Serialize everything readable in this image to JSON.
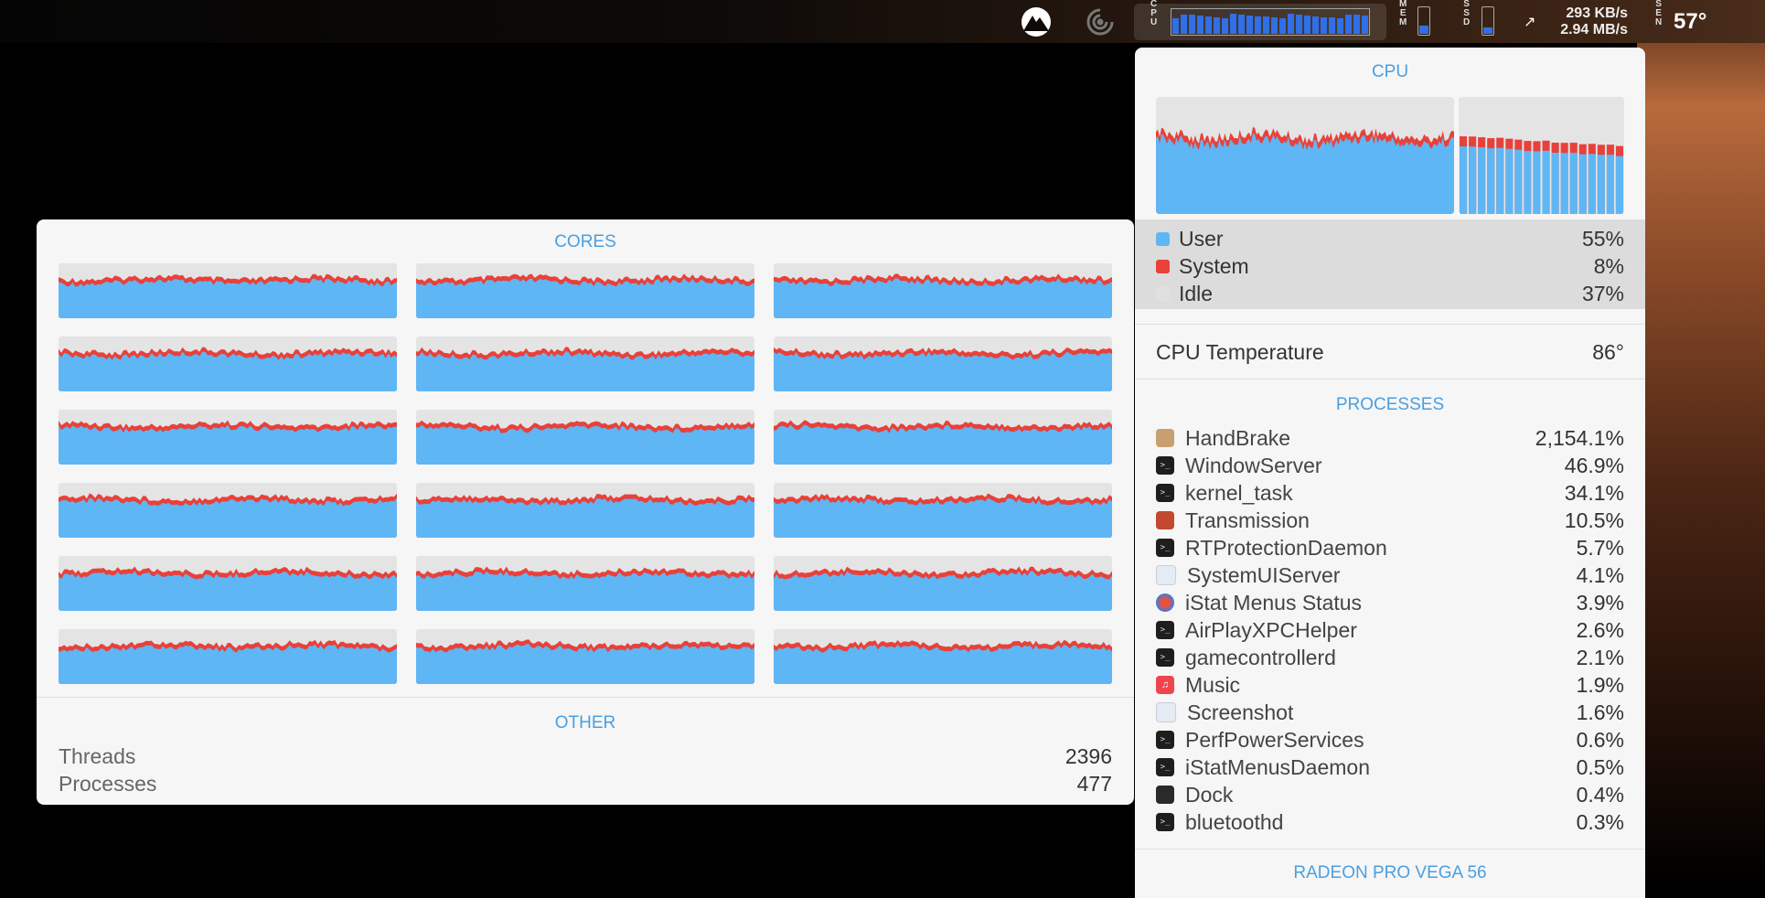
{
  "menubar": {
    "cpu_label": [
      "C",
      "P",
      "U"
    ],
    "mem_label": [
      "M",
      "E",
      "M"
    ],
    "ssd_label": [
      "S",
      "S",
      "D"
    ],
    "sen_label": [
      "S",
      "E",
      "N"
    ],
    "net_up": "293 KB/s",
    "net_down": "2.94 MB/s",
    "temperature": "57°",
    "mem_fill_percent": 30,
    "ssd_fill_percent": 25
  },
  "cores_panel": {
    "title": "CORES",
    "core_count": 18,
    "other_title": "OTHER",
    "stats": [
      {
        "label": "Threads",
        "value": "2396"
      },
      {
        "label": "Processes",
        "value": "477"
      }
    ]
  },
  "cpu_panel": {
    "title": "CPU",
    "legend": [
      {
        "label": "User",
        "value": "55%",
        "color": "#5fb6f5"
      },
      {
        "label": "System",
        "value": "8%",
        "color": "#e8413a"
      },
      {
        "label": "Idle",
        "value": "37%",
        "color": "#e0e0e0"
      }
    ],
    "temperature_label": "CPU Temperature",
    "temperature_value": "86°",
    "processes_title": "PROCESSES",
    "processes": [
      {
        "name": "HandBrake",
        "value": "2,154.1%",
        "icon": "handbrake-icon"
      },
      {
        "name": "WindowServer",
        "value": "46.9%",
        "icon": "terminal-icon"
      },
      {
        "name": "kernel_task",
        "value": "34.1%",
        "icon": "terminal-icon"
      },
      {
        "name": "Transmission",
        "value": "10.5%",
        "icon": "transmission-icon"
      },
      {
        "name": "RTProtectionDaemon",
        "value": "5.7%",
        "icon": "terminal-icon"
      },
      {
        "name": "SystemUIServer",
        "value": "4.1%",
        "icon": "system-icon"
      },
      {
        "name": "iStat Menus Status",
        "value": "3.9%",
        "icon": "istat-icon"
      },
      {
        "name": "AirPlayXPCHelper",
        "value": "2.6%",
        "icon": "terminal-icon"
      },
      {
        "name": "gamecontrollerd",
        "value": "2.1%",
        "icon": "terminal-icon"
      },
      {
        "name": "Music",
        "value": "1.9%",
        "icon": "music-icon"
      },
      {
        "name": "Screenshot",
        "value": "1.6%",
        "icon": "system-icon"
      },
      {
        "name": "PerfPowerServices",
        "value": "0.6%",
        "icon": "terminal-icon"
      },
      {
        "name": "iStatMenusDaemon",
        "value": "0.5%",
        "icon": "terminal-icon"
      },
      {
        "name": "Dock",
        "value": "0.4%",
        "icon": "dock-icon"
      },
      {
        "name": "bluetoothd",
        "value": "0.3%",
        "icon": "terminal-icon"
      }
    ],
    "gpu_title": "RADEON PRO VEGA 56"
  },
  "colors": {
    "user": "#5fb6f5",
    "system": "#e8413a",
    "accent": "#4a9fe0"
  }
}
